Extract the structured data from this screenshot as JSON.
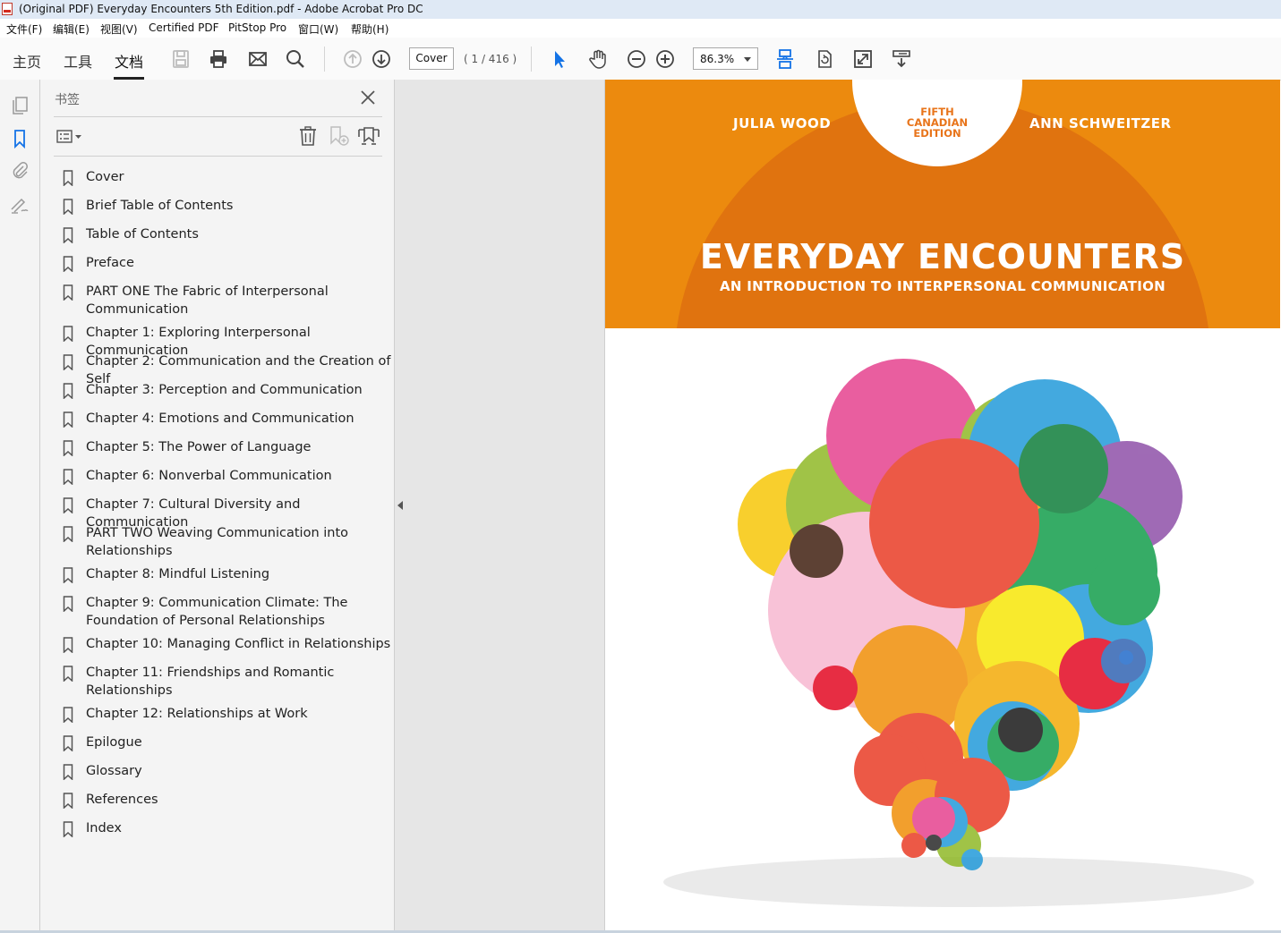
{
  "window": {
    "title": "(Original PDF) Everyday Encounters 5th Edition.pdf - Adobe Acrobat Pro DC"
  },
  "menu": [
    "文件(F)",
    "编辑(E)",
    "视图(V)",
    "Certified PDF",
    "PitStop Pro",
    "窗口(W)",
    "帮助(H)"
  ],
  "nav_tabs": [
    "主页",
    "工具",
    "文档"
  ],
  "page_nav": {
    "current": "Cover",
    "count": "( 1 / 416 )"
  },
  "zoom": {
    "value": "86.3%"
  },
  "bookmarks_panel": {
    "title": "书签",
    "items": [
      "Cover",
      "Brief Table of Contents",
      "Table of Contents",
      "Preface",
      "PART ONE The Fabric of Interpersonal Communication",
      "Chapter 1: Exploring Interpersonal Communication",
      "Chapter 2: Communication and the Creation of Self",
      "Chapter 3: Perception and Communication",
      "Chapter 4: Emotions and Communication",
      "Chapter 5: The Power of Language",
      "Chapter 6: Nonverbal Communication",
      "Chapter 7: Cultural Diversity and Communication",
      "PART TWO Weaving Communication into Relationships",
      "Chapter 8: Mindful Listening",
      "Chapter 9: Communication Climate: The Foundation of Personal Relationships",
      "Chapter 10: Managing Conflict in Relationships",
      "Chapter 11: Friendships and Romantic Relationships",
      "Chapter 12: Relationships at Work",
      "Epilogue",
      "Glossary",
      "References",
      "Index"
    ]
  },
  "cover": {
    "author_left": "JULIA WOOD",
    "author_right": "ANN SCHWEITZER",
    "edition": [
      "FIFTH",
      "CANADIAN",
      "EDITION"
    ],
    "title": "EVERYDAY ENCOUNTERS",
    "subtitle": "AN INTRODUCTION TO INTERPERSONAL COMMUNICATION"
  },
  "colors": {
    "cover_orange": "#ec8a0e",
    "cover_orange_dark": "#e0730f",
    "accent_blue": "#1473e6"
  }
}
